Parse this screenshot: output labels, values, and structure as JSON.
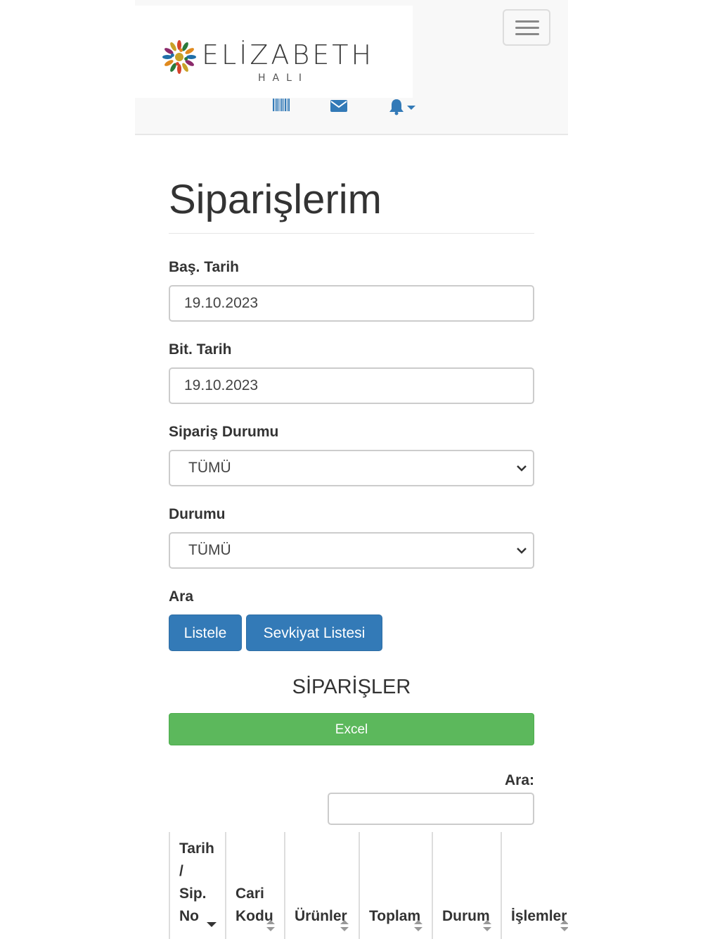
{
  "brand": {
    "name": "ELİZABETH",
    "tagline": "HALI"
  },
  "page": {
    "title": "Siparişlerim"
  },
  "form": {
    "start_date": {
      "label": "Baş. Tarih",
      "value": "19.10.2023"
    },
    "end_date": {
      "label": "Bit. Tarih",
      "value": "19.10.2023"
    },
    "order_status": {
      "label": "Sipariş Durumu",
      "selected": "TÜMÜ"
    },
    "status": {
      "label": "Durumu",
      "selected": "TÜMÜ"
    },
    "search_label": "Ara",
    "list_button": "Listele",
    "shipment_button": "Sevkiyat Listesi"
  },
  "orders": {
    "title": "SİPARİŞLER",
    "excel_button": "Excel",
    "search_label": "Ara:",
    "search_value": "",
    "columns": [
      {
        "lines": [
          "Tarih",
          "/",
          "Sip.",
          "No"
        ]
      },
      {
        "lines": [
          "Cari",
          "Kodu"
        ]
      },
      {
        "lines": [
          "Ürünler"
        ]
      },
      {
        "lines": [
          "Toplam"
        ]
      },
      {
        "lines": [
          "Durum"
        ]
      },
      {
        "lines": [
          "İşlemler"
        ]
      }
    ]
  },
  "colors": {
    "primary": "#337ab7",
    "success": "#5cb85c",
    "navbar_bg": "#f8f8f8"
  },
  "icons": [
    "barcode-icon",
    "envelope-icon",
    "bell-icon",
    "caret-down-icon",
    "menu-icon",
    "chevron-down-icon",
    "sort-icon",
    "sort-desc-icon"
  ]
}
